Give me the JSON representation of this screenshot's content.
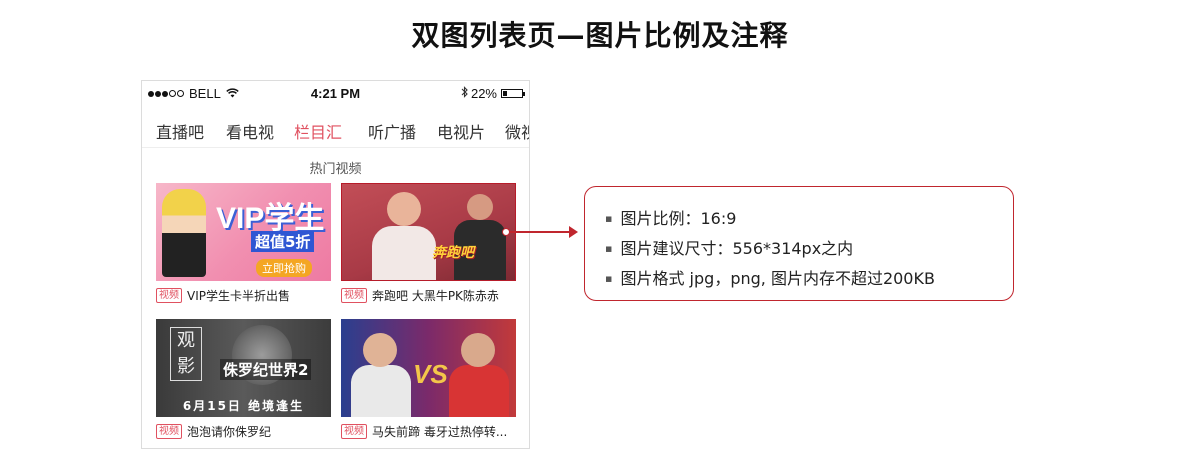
{
  "page_title": "双图列表页—图片比例及注释",
  "statusbar": {
    "carrier": "BELL",
    "time": "4:21 PM",
    "battery": "22%",
    "battery_level": 0.22,
    "signal_dots_filled": 3,
    "signal_dots_total": 5,
    "icons": [
      "wifi-icon",
      "bluetooth-icon",
      "battery-icon"
    ]
  },
  "tabs": [
    {
      "label": "直播吧",
      "active": false
    },
    {
      "label": "看电视",
      "active": false
    },
    {
      "label": "栏目汇",
      "active": true
    },
    {
      "label": "听广播",
      "active": false
    },
    {
      "label": "电视片",
      "active": false
    },
    {
      "label": "微视",
      "active": false
    }
  ],
  "section_title": "热门视频",
  "cards": [
    {
      "tag": "视频",
      "title": "VIP学生卡半折出售",
      "thumb_text": {
        "main": "VIP学生",
        "sub": "超值5折",
        "button": "立即抢购"
      }
    },
    {
      "tag": "视频",
      "title": "奔跑吧 大黑牛PK陈赤赤",
      "thumb_text": {
        "logo": "奔跑吧"
      }
    },
    {
      "tag": "视频",
      "title": "泡泡请你侏罗纪",
      "thumb_text": {
        "badge": "观影",
        "name": "侏罗纪世界2",
        "date": "6月15日 绝境逢生"
      }
    },
    {
      "tag": "视频",
      "title": "马失前蹄 毒牙过热停转...",
      "thumb_text": {
        "vs": "VS"
      }
    }
  ],
  "notes": [
    "图片比例：16:9",
    "图片建议尺寸：556*314px之内",
    "图片格式  jpg，png, 图片内存不超过200KB"
  ],
  "colors": {
    "accent": "#e05160",
    "annotation": "#c0262e"
  }
}
